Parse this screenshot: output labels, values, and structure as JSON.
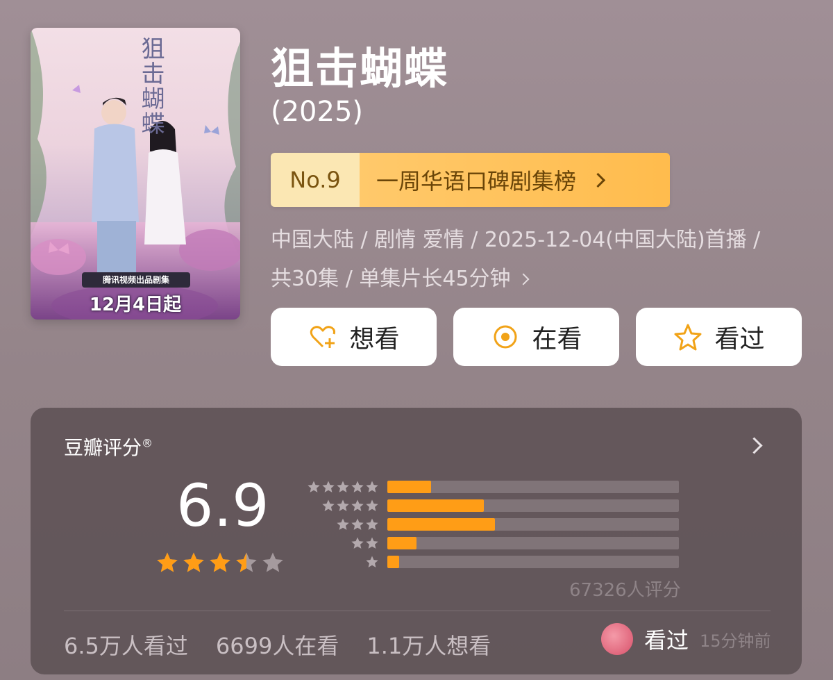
{
  "poster": {
    "title_art": "狙击蝴蝶",
    "badge": "腾讯视频出品剧集",
    "release": "12月4日起"
  },
  "show": {
    "title": "狙击蝴蝶",
    "year": "(2025)"
  },
  "rank": {
    "number": "No.9",
    "label": "一周华语口碑剧集榜"
  },
  "meta": {
    "line1": "中国大陆 / 剧情 爱情 / 2025-12-04(中国大陆)首播 /",
    "line2": "共30集 / 单集片长45分钟"
  },
  "actions": [
    {
      "label": "想看",
      "icon": "heart-plus-icon"
    },
    {
      "label": "在看",
      "icon": "target-icon"
    },
    {
      "label": "看过",
      "icon": "star-outline-icon"
    }
  ],
  "rating": {
    "title": "豆瓣评分",
    "mark": "®",
    "score": "6.9",
    "stars_value": 3.5,
    "distribution": [
      {
        "stars": 5,
        "fraction": 0.15
      },
      {
        "stars": 4,
        "fraction": 0.33
      },
      {
        "stars": 3,
        "fraction": 0.37
      },
      {
        "stars": 2,
        "fraction": 0.1
      },
      {
        "stars": 1,
        "fraction": 0.04
      }
    ],
    "count": "67326人评分"
  },
  "stats": {
    "watched": "6.5万人看过",
    "watching": "6699人在看",
    "wish": "1.1万人想看"
  },
  "friend": {
    "action": "看过",
    "time": "15分钟前"
  },
  "colors": {
    "accent": "#ff9d16",
    "rank_bg": "#ffc96b"
  }
}
